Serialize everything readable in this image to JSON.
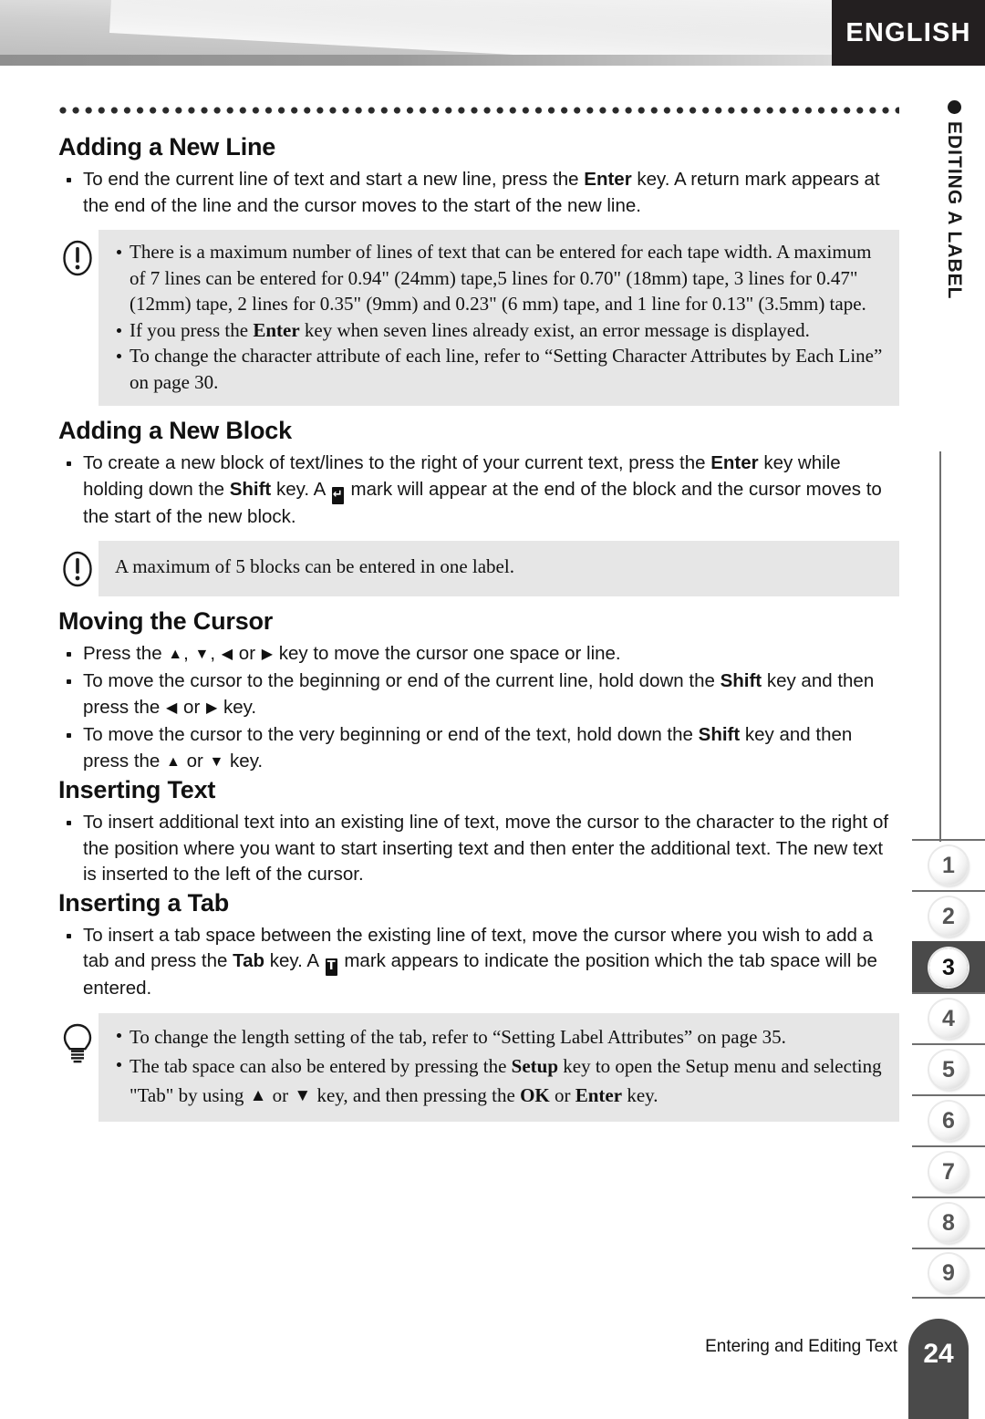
{
  "header": {
    "language_tab": "ENGLISH"
  },
  "side_tab": {
    "label": "EDITING A LABEL",
    "bullet_icon": "filled-circle-icon"
  },
  "sections": [
    {
      "id": "adding-a-new-line",
      "title": "Adding a New Line",
      "bullets": [
        {
          "parts": [
            {
              "t": "text",
              "v": "To end the current line of text and start a new line, press the "
            },
            {
              "t": "bold",
              "v": "Enter"
            },
            {
              "t": "text",
              "v": " key. A return mark appears at the end of the line and the cursor moves to the start of the new line."
            }
          ]
        }
      ],
      "callout": {
        "icon": "warning-exclamation-icon",
        "items": [
          {
            "parts": [
              {
                "t": "text",
                "v": "There is a maximum number of lines of text that can be entered for each tape width. A maximum of 7 lines can be entered for 0.94\" (24mm) tape,5 lines for 0.70\" (18mm) tape, 3 lines for 0.47\" (12mm) tape, 2 lines for 0.35\" (9mm) and 0.23\" (6 mm) tape, and 1 line for 0.13\" (3.5mm) tape."
              }
            ]
          },
          {
            "parts": [
              {
                "t": "text",
                "v": "If you press the "
              },
              {
                "t": "bold",
                "v": "Enter"
              },
              {
                "t": "text",
                "v": " key when seven lines already exist, an error message is displayed."
              }
            ]
          },
          {
            "parts": [
              {
                "t": "text",
                "v": "To change the character attribute of each line, refer to “Setting Character Attributes by Each Line” on page 30."
              }
            ]
          }
        ]
      }
    },
    {
      "id": "adding-a-new-block",
      "title": "Adding a New Block",
      "bullets": [
        {
          "parts": [
            {
              "t": "text",
              "v": "To create a new block of text/lines to the right of your current text, press the "
            },
            {
              "t": "bold",
              "v": "Enter"
            },
            {
              "t": "text",
              "v": " key while holding down the "
            },
            {
              "t": "bold",
              "v": "Shift"
            },
            {
              "t": "text",
              "v": " key. A "
            },
            {
              "t": "keymark",
              "v": "↵",
              "name": "return-block-mark-icon"
            },
            {
              "t": "text",
              "v": " mark will appear at the end of the block and the cursor moves to the start of the new block."
            }
          ]
        }
      ],
      "callout": {
        "icon": "warning-exclamation-icon",
        "plain": "A maximum of 5 blocks can be entered in one label."
      }
    },
    {
      "id": "moving-the-cursor",
      "title": "Moving the Cursor",
      "bullets": [
        {
          "parts": [
            {
              "t": "text",
              "v": "Press the "
            },
            {
              "t": "arrow",
              "v": "▲",
              "name": "arrow-up-icon"
            },
            {
              "t": "text",
              "v": ", "
            },
            {
              "t": "arrow",
              "v": "▼",
              "name": "arrow-down-icon"
            },
            {
              "t": "text",
              "v": ", "
            },
            {
              "t": "arrow",
              "v": "◀",
              "name": "arrow-left-icon"
            },
            {
              "t": "text",
              "v": " or "
            },
            {
              "t": "arrow",
              "v": "▶",
              "name": "arrow-right-icon"
            },
            {
              "t": "text",
              "v": " key to move the cursor one space or line."
            }
          ]
        },
        {
          "parts": [
            {
              "t": "text",
              "v": "To move the cursor to the beginning or end of the current line, hold down the "
            },
            {
              "t": "bold",
              "v": "Shift"
            },
            {
              "t": "text",
              "v": " key and then press the "
            },
            {
              "t": "arrow",
              "v": "◀",
              "name": "arrow-left-icon"
            },
            {
              "t": "text",
              "v": " or "
            },
            {
              "t": "arrow",
              "v": "▶",
              "name": "arrow-right-icon"
            },
            {
              "t": "text",
              "v": " key."
            }
          ]
        },
        {
          "parts": [
            {
              "t": "text",
              "v": "To move the cursor to the very beginning or end of the text, hold down the "
            },
            {
              "t": "bold",
              "v": "Shift"
            },
            {
              "t": "text",
              "v": " key and then press the "
            },
            {
              "t": "arrow",
              "v": "▲",
              "name": "arrow-up-icon"
            },
            {
              "t": "text",
              "v": " or "
            },
            {
              "t": "arrow",
              "v": "▼",
              "name": "arrow-down-icon"
            },
            {
              "t": "text",
              "v": " key."
            }
          ]
        }
      ]
    },
    {
      "id": "inserting-text",
      "title": "Inserting Text",
      "bullets": [
        {
          "parts": [
            {
              "t": "text",
              "v": "To insert additional text into an existing line of text, move the cursor to the character to the right of the position where you want to start inserting text and then enter the additional text. The new text is inserted to the left of the cursor."
            }
          ]
        }
      ]
    },
    {
      "id": "inserting-a-tab",
      "title": "Inserting a Tab",
      "bullets": [
        {
          "parts": [
            {
              "t": "text",
              "v": "To insert a tab space between the existing line of text, move the cursor where you wish to add a tab and press the "
            },
            {
              "t": "bold",
              "v": "Tab"
            },
            {
              "t": "text",
              "v": " key. A "
            },
            {
              "t": "keymark",
              "v": "T",
              "name": "tab-mark-icon"
            },
            {
              "t": "text",
              "v": " mark appears to indicate the position which the tab space will be entered."
            }
          ]
        }
      ],
      "callout": {
        "icon": "lightbulb-tip-icon",
        "class": "tip",
        "items": [
          {
            "parts": [
              {
                "t": "text",
                "v": "To change the length setting of the tab, refer to “Setting Label Attributes” on page 35."
              }
            ]
          },
          {
            "parts": [
              {
                "t": "text",
                "v": "The tab space can also be entered by pressing the "
              },
              {
                "t": "bold",
                "v": "Setup"
              },
              {
                "t": "text",
                "v": " key to open the Setup menu and selecting \"Tab\" by using "
              },
              {
                "t": "arrow-big",
                "v": "▲",
                "name": "arrow-up-icon"
              },
              {
                "t": "text",
                "v": " or "
              },
              {
                "t": "arrow-big",
                "v": "▼",
                "name": "arrow-down-icon"
              },
              {
                "t": "text",
                "v": " key, and then pressing the "
              },
              {
                "t": "bold",
                "v": "OK"
              },
              {
                "t": "text",
                "v": " or "
              },
              {
                "t": "bold",
                "v": "Enter"
              },
              {
                "t": "text",
                "v": " key."
              }
            ]
          }
        ]
      }
    }
  ],
  "chapter_tabs": {
    "items": [
      "1",
      "2",
      "3",
      "4",
      "5",
      "6",
      "7",
      "8",
      "9"
    ],
    "active": "3"
  },
  "footer": {
    "text": "Entering and Editing Text",
    "page_number": "24"
  },
  "colors": {
    "dark_tab": "#231f20",
    "active_tab": "#4a4a4a",
    "callout_bg": "#e6e6e6",
    "rule": "#6f6f6f"
  }
}
